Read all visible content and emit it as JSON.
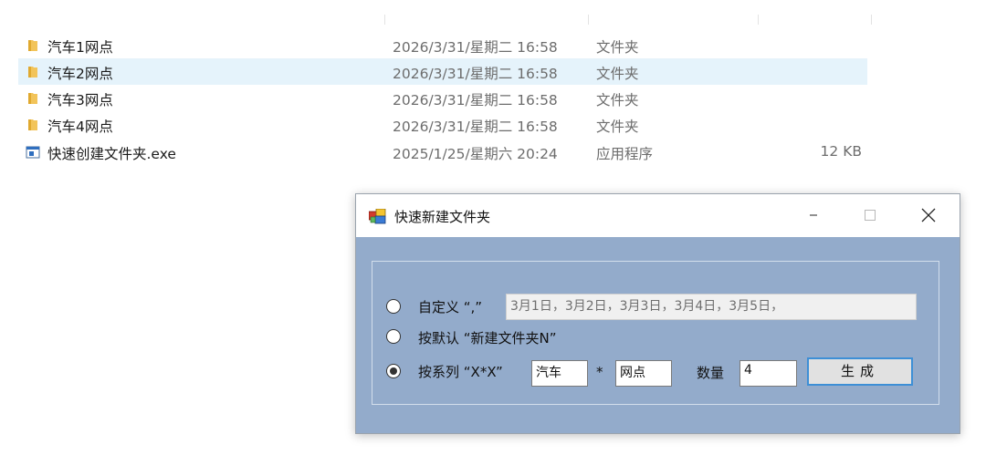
{
  "explorer": {
    "files": [
      {
        "name": "汽车1网点",
        "date": "2026/3/31/星期二 16:58",
        "type": "文件夹",
        "size": "",
        "kind": "folder-icon",
        "selected": false
      },
      {
        "name": "汽车2网点",
        "date": "2026/3/31/星期二 16:58",
        "type": "文件夹",
        "size": "",
        "kind": "folder-icon",
        "selected": true
      },
      {
        "name": "汽车3网点",
        "date": "2026/3/31/星期二 16:58",
        "type": "文件夹",
        "size": "",
        "kind": "folder-icon",
        "selected": false
      },
      {
        "name": "汽车4网点",
        "date": "2026/3/31/星期二 16:58",
        "type": "文件夹",
        "size": "",
        "kind": "folder-icon",
        "selected": false
      },
      {
        "name": "快速创建文件夹.exe",
        "date": "2025/1/25/星期六 20:24",
        "type": "应用程序",
        "size": "12 KB",
        "kind": "application-icon",
        "selected": false
      }
    ]
  },
  "dialog": {
    "title": "快速新建文件夹",
    "options": {
      "custom_label": "自定义 “,”",
      "custom_value": "3月1日，3月2日，3月3日，3月4日，3月5日，",
      "default_label": "按默认 “新建文件夹N”",
      "series_label": "按系列 “X*X”",
      "series_first": "汽车",
      "star": "*",
      "series_second": "网点",
      "count_label": "数量",
      "count_value": "4",
      "generate_label": "生成"
    },
    "selected_option": "series"
  },
  "colors": {
    "selection": "#e5f3fb",
    "dialog_client": "#93abcb",
    "button_focus": "#3d8fd6",
    "folder": "#f2c45a"
  }
}
